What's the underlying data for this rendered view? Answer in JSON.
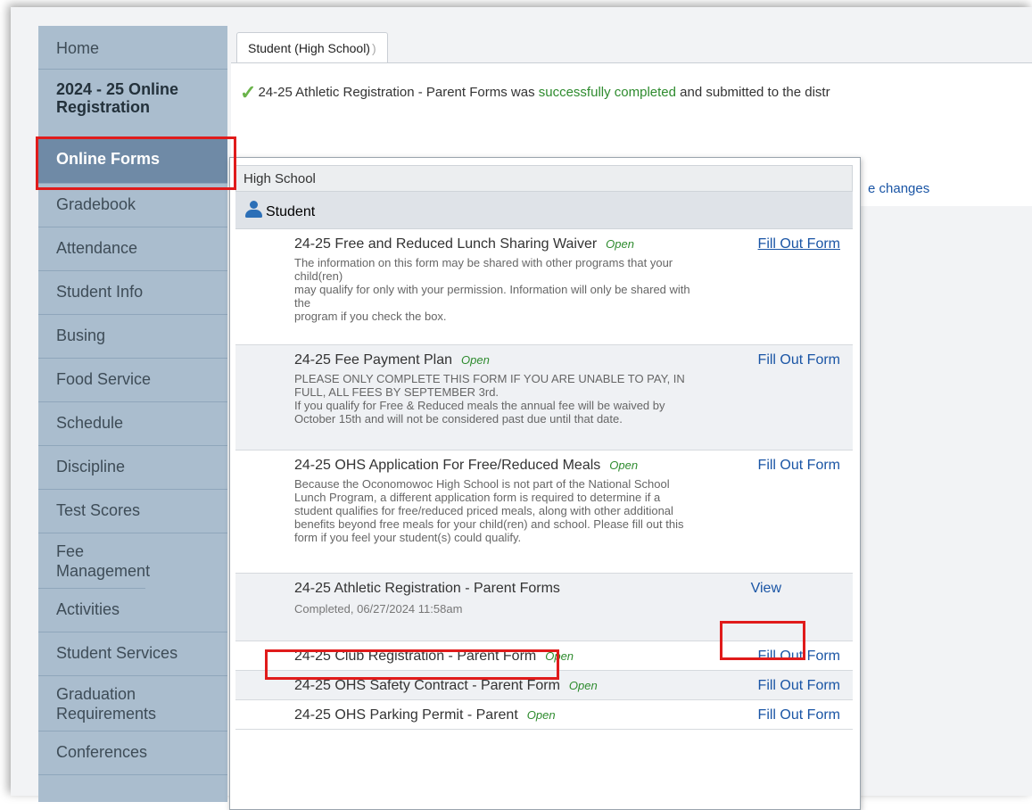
{
  "sidebar": {
    "items": [
      {
        "label": "Home"
      },
      {
        "label": "2024 - 25 Online Registration"
      },
      {
        "label": "Online Forms"
      },
      {
        "label": "Gradebook"
      },
      {
        "label": "Attendance"
      },
      {
        "label": "Student Info"
      },
      {
        "label": "Busing"
      },
      {
        "label": "Food Service"
      },
      {
        "label": "Schedule"
      },
      {
        "label": "Discipline"
      },
      {
        "label": "Test Scores"
      },
      {
        "label": "Fee Management"
      },
      {
        "label": "Activities"
      },
      {
        "label": "Student Services"
      },
      {
        "label": "Graduation Requirements"
      },
      {
        "label": "Conferences"
      }
    ]
  },
  "tab": {
    "label": "Student (High School)"
  },
  "banner": {
    "form_name": "24-25 Athletic Registration - Parent Forms",
    "was_text": " was ",
    "success_text": "successfully completed",
    "rest_text": " and submitted to the distr"
  },
  "main": {
    "changes_text": "e changes"
  },
  "panel": {
    "header": "High School",
    "student_label": "Student",
    "forms": [
      {
        "title": "24-25 Free and Reduced Lunch Sharing Waiver",
        "status": "Open",
        "action": "Fill Out Form",
        "description": "The information on this form may be shared with other programs that your\nchild(ren)\nmay qualify for only with your permission. Information will only be shared with\nthe\nprogram if you check the box."
      },
      {
        "title": "24-25 Fee Payment Plan",
        "status": "Open",
        "action": "Fill Out Form",
        "description": "PLEASE ONLY COMPLETE THIS FORM IF YOU ARE UNABLE TO PAY, IN\nFULL, ALL FEES BY SEPTEMBER 3rd.\nIf you qualify for Free & Reduced meals the annual fee will be waived by\nOctober 15th and will not be considered past due until that date."
      },
      {
        "title": "24-25 OHS Application For Free/Reduced Meals",
        "status": "Open",
        "action": "Fill Out Form",
        "description": "Because the Oconomowoc High School is not part of the National School\nLunch Program, a different application form is required to determine if a\nstudent qualifies for free/reduced priced meals, along with other additional\nbenefits beyond free meals for your child(ren) and school. Please fill out this\nform if you feel your student(s) could qualify."
      },
      {
        "title": "24-25 Athletic Registration - Parent Forms",
        "action": "View",
        "completed": "Completed, 06/27/2024 11:58am"
      },
      {
        "title": "24-25 Club Registration - Parent Form",
        "status": "Open",
        "action": "Fill Out Form"
      },
      {
        "title": "24-25 OHS Safety Contract - Parent Form",
        "status": "Open",
        "action": "Fill Out Form"
      },
      {
        "title": "24-25 OHS Parking Permit - Parent",
        "status": "Open",
        "action": "Fill Out Form"
      }
    ]
  },
  "colors": {
    "sidebar_bg": "#aabdce",
    "active_nav": "#6f8aa6",
    "link": "#1a55a5",
    "open_status": "#2e8b2e",
    "highlight_box": "#e01b1b"
  }
}
